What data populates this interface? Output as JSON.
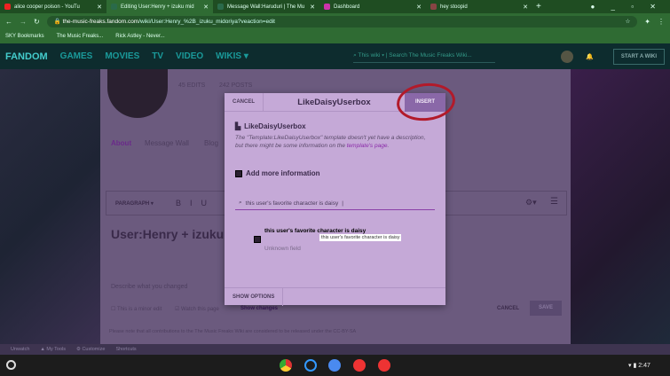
{
  "browser": {
    "tabs": [
      {
        "title": "alice cooper poison - YouTu",
        "color": "#e22"
      },
      {
        "title": "Editing User:Henry + izuku mid",
        "color": "#2a6a4a"
      },
      {
        "title": "Message Wall:Haruduri | The Mu",
        "color": "#2a6a4a"
      },
      {
        "title": "Dashboard",
        "color": "#c3a"
      },
      {
        "title": "hey stoopid",
        "color": "#844"
      }
    ],
    "url_domain": "the-music-freaks.fandom.com",
    "url_path": "/wiki/User:Henry_%2B_izuku_midoriya?veaction=edit",
    "bookmarks": [
      "SKY Bookmarks",
      "The Music Freaks...",
      "Rick Astley - Never..."
    ]
  },
  "fandom": {
    "logo": "FANDOM",
    "nav": [
      "GAMES",
      "MOVIES",
      "TV",
      "VIDEO",
      "WIKIS ▾"
    ],
    "search_scope": "This wiki ▾",
    "search_placeholder": "Search The Music Freaks Wiki...",
    "start_wiki": "START A WIKI"
  },
  "profile": {
    "edits": "45 EDITS",
    "posts": "242 POSTS",
    "tabs": [
      "About",
      "Message Wall",
      "Blog"
    ]
  },
  "editor": {
    "paragraph": "PARAGRAPH ▾",
    "page_title": "User:Henry + izuku",
    "summary_placeholder": "Describe what you changed",
    "minor_edit": "This is a minor edit",
    "watch": "Watch this page",
    "show_changes": "Show changes",
    "cancel": "CANCEL",
    "save": "SAVE",
    "license": "Please note that all contributions to the The Music Freaks Wiki are considered to be released under the CC-BY-SA"
  },
  "toolbar": [
    "Unwatch",
    "▲ My Tools",
    "⚙ Customize",
    "Shortcuts"
  ],
  "modal": {
    "cancel": "CANCEL",
    "title": "LikeDaisyUserbox",
    "insert": "INSERT",
    "template_name": "LikeDaisyUserbox",
    "description": "The \"Template:LikeDaisyUserbox\" template doesn't yet have a description, but there might be some information on the",
    "link": "template's page",
    "add_more": "Add more information",
    "search_value": "this user's favorite character is daisy",
    "field_name": "this user's favorite character is daisy",
    "field_tooltip": "this user's favorite character is daisy",
    "field_status": "Unknown field",
    "show_options": "SHOW OPTIONS"
  },
  "system": {
    "time": "2:47"
  }
}
